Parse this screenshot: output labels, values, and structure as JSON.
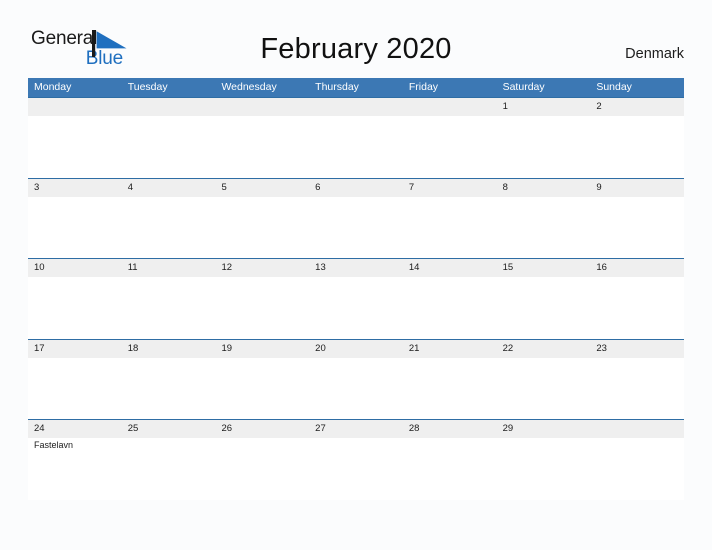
{
  "brand": {
    "name_line1": "General",
    "name_line2": "Blue",
    "flag_icon": "blue-triangle-flag-icon",
    "color_text": "#1a1a1a",
    "color_blue": "#1f6fbf"
  },
  "header": {
    "title": "February 2020",
    "region": "Denmark"
  },
  "theme": {
    "header_blue": "#3c78b4",
    "row_rule_blue": "#2e6da4",
    "band_gray": "#efefef",
    "page_background": "#fbfcfd"
  },
  "calendar": {
    "month": "February",
    "year": "2020",
    "weekday_headers": [
      "Monday",
      "Tuesday",
      "Wednesday",
      "Thursday",
      "Friday",
      "Saturday",
      "Sunday"
    ],
    "weeks": [
      {
        "days": [
          {
            "num": "",
            "event": ""
          },
          {
            "num": "",
            "event": ""
          },
          {
            "num": "",
            "event": ""
          },
          {
            "num": "",
            "event": ""
          },
          {
            "num": "",
            "event": ""
          },
          {
            "num": "1",
            "event": ""
          },
          {
            "num": "2",
            "event": ""
          }
        ]
      },
      {
        "days": [
          {
            "num": "3",
            "event": ""
          },
          {
            "num": "4",
            "event": ""
          },
          {
            "num": "5",
            "event": ""
          },
          {
            "num": "6",
            "event": ""
          },
          {
            "num": "7",
            "event": ""
          },
          {
            "num": "8",
            "event": ""
          },
          {
            "num": "9",
            "event": ""
          }
        ]
      },
      {
        "days": [
          {
            "num": "10",
            "event": ""
          },
          {
            "num": "11",
            "event": ""
          },
          {
            "num": "12",
            "event": ""
          },
          {
            "num": "13",
            "event": ""
          },
          {
            "num": "14",
            "event": ""
          },
          {
            "num": "15",
            "event": ""
          },
          {
            "num": "16",
            "event": ""
          }
        ]
      },
      {
        "days": [
          {
            "num": "17",
            "event": ""
          },
          {
            "num": "18",
            "event": ""
          },
          {
            "num": "19",
            "event": ""
          },
          {
            "num": "20",
            "event": ""
          },
          {
            "num": "21",
            "event": ""
          },
          {
            "num": "22",
            "event": ""
          },
          {
            "num": "23",
            "event": ""
          }
        ]
      },
      {
        "days": [
          {
            "num": "24",
            "event": "Fastelavn"
          },
          {
            "num": "25",
            "event": ""
          },
          {
            "num": "26",
            "event": ""
          },
          {
            "num": "27",
            "event": ""
          },
          {
            "num": "28",
            "event": ""
          },
          {
            "num": "29",
            "event": ""
          },
          {
            "num": "",
            "event": ""
          }
        ]
      }
    ]
  }
}
